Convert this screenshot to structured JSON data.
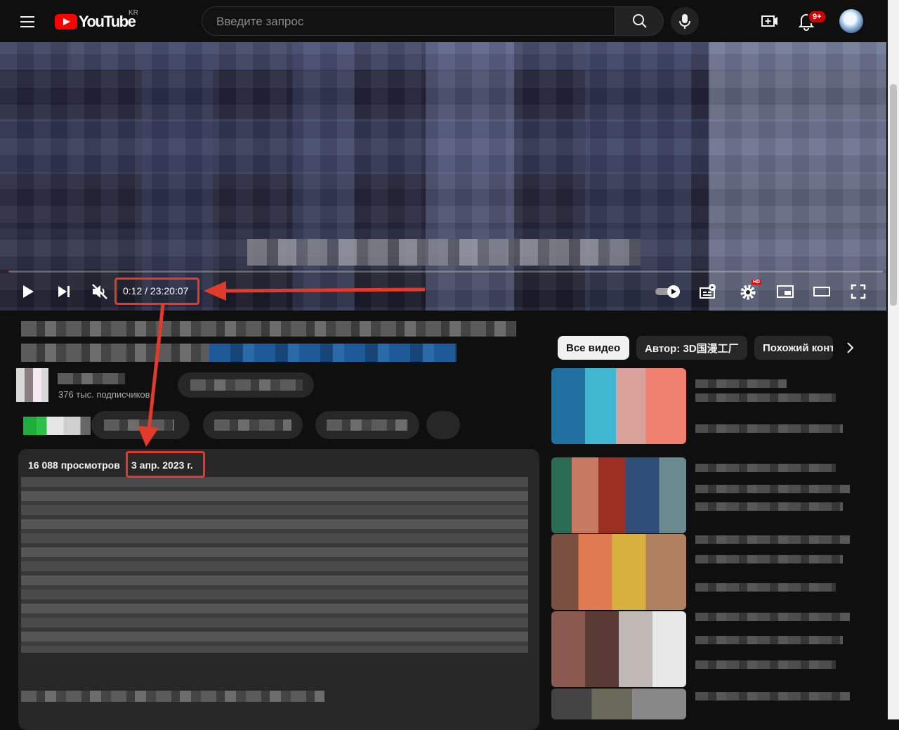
{
  "masthead": {
    "logo_text": "YouTube",
    "region": "KR",
    "search_placeholder": "Введите запрос",
    "notification_count": "9+"
  },
  "player": {
    "time_display": "0:12 / 23:20:07",
    "progress_fraction": 0.0001,
    "hd_badge": "HD"
  },
  "channel": {
    "subscribers": "376 тыс. подписчиков"
  },
  "description": {
    "views": "16 088 просмотров",
    "date": "3 апр. 2023 г."
  },
  "chips": [
    {
      "label": "Все видео"
    },
    {
      "label": "Автор: 3D国漫工厂"
    },
    {
      "label": "Похожий контент"
    }
  ],
  "annotation_color": "#e23a2b",
  "accent_color": "#ff0000"
}
